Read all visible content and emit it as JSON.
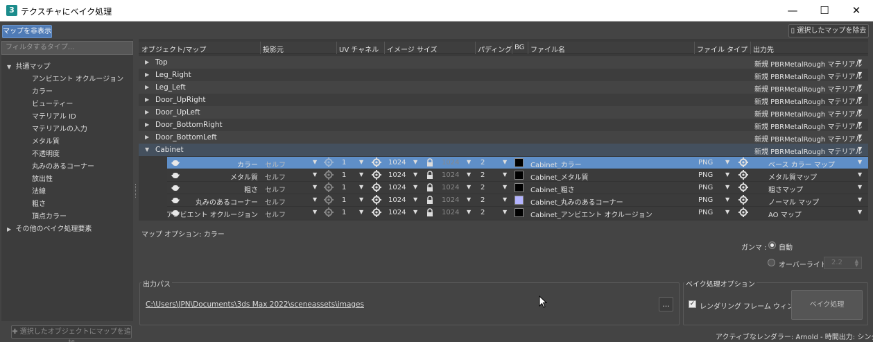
{
  "window": {
    "title": "テクスチャにベイク処理",
    "app_icon": "3"
  },
  "toolbar": {
    "hide_maps": "マップを非表示",
    "remove_selected": "選択したマップを除去"
  },
  "filter": {
    "placeholder": "フィルタするタイプ..."
  },
  "tree": {
    "common_maps": "共通マップ",
    "items": [
      "アンビエント オクルージョン",
      "カラー",
      "ビューティー",
      "マテリアル ID",
      "マテリアルの入力",
      "メタル質",
      "不透明度",
      "丸みのあるコーナー",
      "放出性",
      "法線",
      "粗さ",
      "頂点カラー"
    ],
    "other": "その他のベイク処理要素"
  },
  "add_maps_button": "選択したオブジェクトにマップを追加",
  "columns": [
    "オブジェクト/マップ",
    "投影元",
    "UV チャネル",
    "イメージ サイズ",
    "パディング",
    "BG",
    "ファイル名",
    "ファイル タイプ",
    "出力先"
  ],
  "objects": [
    {
      "name": "Top",
      "output": "新規 PBRMetalRough マテリアル"
    },
    {
      "name": "Leg_Right",
      "output": "新規 PBRMetalRough マテリアル"
    },
    {
      "name": "Leg_Left",
      "output": "新規 PBRMetalRough マテリアル"
    },
    {
      "name": "Door_UpRight",
      "output": "新規 PBRMetalRough マテリアル"
    },
    {
      "name": "Door_UpLeft",
      "output": "新規 PBRMetalRough マテリアル"
    },
    {
      "name": "Door_BottomRight",
      "output": "新規 PBRMetalRough マテリアル"
    },
    {
      "name": "Door_BottomLeft",
      "output": "新規 PBRMetalRough マテリアル"
    },
    {
      "name": "Cabinet",
      "output": "新規 PBRMetalRough マテリアル"
    }
  ],
  "maps": [
    {
      "map": "カラー",
      "source": "セルフ",
      "uv": "1",
      "size": "1024",
      "size2": "1024",
      "padding": "2",
      "bg": "#000000",
      "filename": "Cabinet_カラー",
      "filetype": "PNG",
      "output": "ベース カラー マップ"
    },
    {
      "map": "メタル質",
      "source": "セルフ",
      "uv": "1",
      "size": "1024",
      "size2": "1024",
      "padding": "2",
      "bg": "#000000",
      "filename": "Cabinet_メタル質",
      "filetype": "PNG",
      "output": "メタル質マップ"
    },
    {
      "map": "粗さ",
      "source": "セルフ",
      "uv": "1",
      "size": "1024",
      "size2": "1024",
      "padding": "2",
      "bg": "#000000",
      "filename": "Cabinet_粗さ",
      "filetype": "PNG",
      "output": "粗さマップ"
    },
    {
      "map": "丸みのあるコーナー",
      "source": "セルフ",
      "uv": "1",
      "size": "1024",
      "size2": "1024",
      "padding": "2",
      "bg": "#b4b4ff",
      "filename": "Cabinet_丸みのあるコーナー",
      "filetype": "PNG",
      "output": "ノーマル マップ"
    },
    {
      "map": "アンビエント オクルージョン",
      "source": "セルフ",
      "uv": "1",
      "size": "1024",
      "size2": "1024",
      "padding": "2",
      "bg": "#000000",
      "filename": "Cabinet_アンビエント オクルージョン",
      "filetype": "PNG",
      "output": "AO マップ"
    }
  ],
  "map_options": {
    "label": "マップ オプション: カラー",
    "gamma": "ガンマ :",
    "auto": "自動",
    "override": "オーバーライド",
    "override_value": "2.2"
  },
  "output_path": {
    "label": "出力パス",
    "path": "C:\\Users\\JPN\\Documents\\3ds Max 2022\\sceneassets\\images",
    "browse": "..."
  },
  "bake_options": {
    "label": "ベイク処理オプション",
    "frame_window": "レンダリング フレーム ウィンドウ",
    "bake_button": "ベイク処理"
  },
  "status": "アクティブなレンダラー: Arnold - 時間出力: シングル"
}
